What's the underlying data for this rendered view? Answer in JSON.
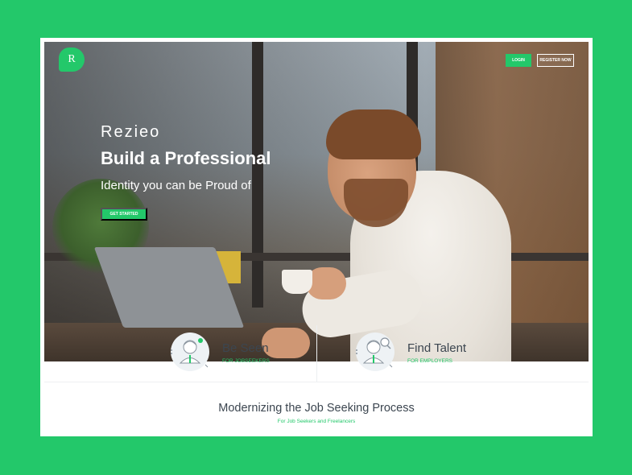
{
  "brand": {
    "logo_letter": "R",
    "name": "Rezieo",
    "accent": "#23c86a"
  },
  "nav": {
    "login_label": "LOGIN",
    "register_label": "REGISTER NOW"
  },
  "hero": {
    "title": "Build a Professional",
    "subtitle": "Identity you can be Proud of",
    "cta_label": "GET STARTED"
  },
  "features": [
    {
      "title": "Be Seen",
      "subtitle": "FOR JOBSEEKERS",
      "icon": "jobseeker-icon"
    },
    {
      "title": "Find Talent",
      "subtitle": "FOR EMPLOYERS",
      "icon": "employer-search-icon"
    }
  ],
  "section": {
    "title": "Modernizing the Job Seeking Process",
    "subtitle": "For Job Seekers and Freelancers"
  }
}
